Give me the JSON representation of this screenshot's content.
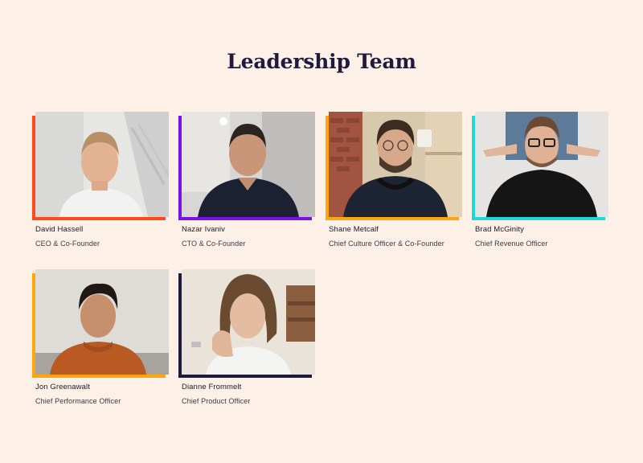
{
  "page": {
    "title": "Leadership Team"
  },
  "members": [
    {
      "name": "David Hassell",
      "role": "CEO & Co-Founder",
      "accent": "#ff4a1c"
    },
    {
      "name": "Nazar Ivaniv",
      "role": "CTO & Co-Founder",
      "accent": "#7a12e8"
    },
    {
      "name": "Shane Metcalf",
      "role": "Chief Culture Officer & Co-Founder",
      "accent": "#ffa50e"
    },
    {
      "name": "Brad McGinity",
      "role": "Chief Revenue Officer",
      "accent": "#1ed8dc"
    },
    {
      "name": "Jon Greenawalt",
      "role": "Chief Performance Officer",
      "accent": "#ffa50e"
    },
    {
      "name": "Dianne Frommelt",
      "role": "Chief Product Officer",
      "accent": "#1c1a3d"
    }
  ],
  "colors": {
    "background": "#fdf0e7",
    "title": "#201a3d"
  }
}
